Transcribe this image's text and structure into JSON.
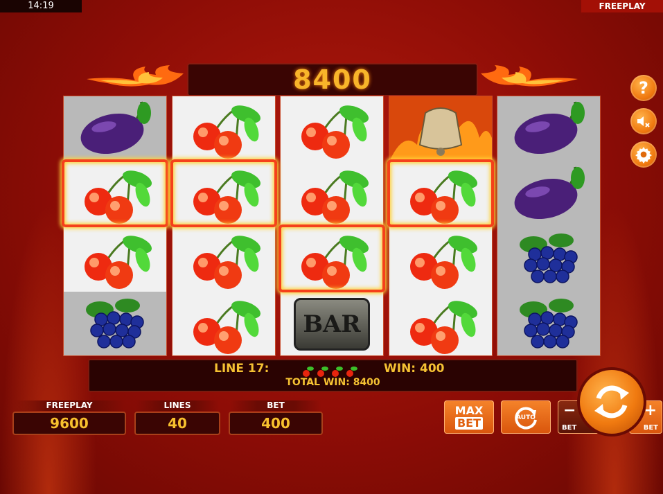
{
  "status": {
    "time": "14:19",
    "mode": "FREEPLAY"
  },
  "win_display": "8400",
  "info": {
    "line": "LINE 17:",
    "win": "WIN: 400",
    "total": "TOTAL WIN: 8400"
  },
  "stats": {
    "freeplay_label": "FREEPLAY",
    "freeplay_value": "9600",
    "lines_label": "LINES",
    "lines_value": "40",
    "bet_label": "BET",
    "bet_value": "400"
  },
  "controls": {
    "max_bet_line1": "MAX",
    "max_bet_line2": "BET",
    "auto": "AUTO",
    "bet_minus": "BET",
    "bet_plus": "BET"
  },
  "bar_symbol": "BAR",
  "reels": [
    [
      "plum",
      "cherries",
      "cherries",
      "grapes"
    ],
    [
      "cherries",
      "cherries",
      "cherries",
      "cherries"
    ],
    [
      "cherries",
      "cherries",
      "cherries",
      "bar"
    ],
    [
      "bell",
      "cherries",
      "cherries",
      "cherries"
    ],
    [
      "plum",
      "plum",
      "grapes",
      "grapes"
    ]
  ],
  "winning_line": "17",
  "icons": {
    "help": "help-icon",
    "sound": "sound-muted-icon",
    "settings": "gear-icon",
    "spin": "spin-arrows-icon"
  },
  "colors": {
    "accent": "#f07a10",
    "gold_text": "#f8c12e",
    "background": "#9e1008"
  }
}
